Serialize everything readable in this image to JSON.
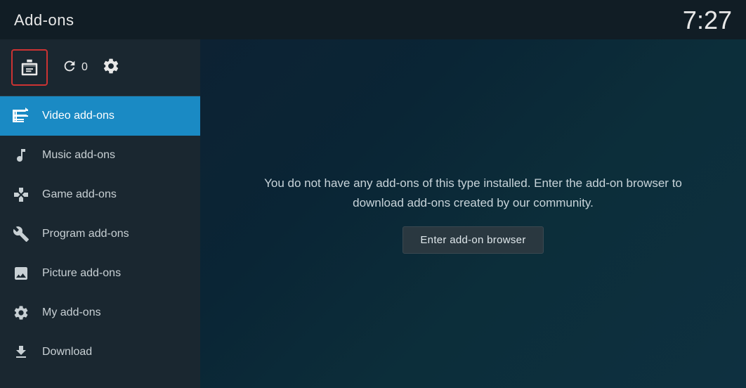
{
  "header": {
    "title": "Add-ons",
    "clock": "7:27"
  },
  "sidebar": {
    "icons": {
      "refresh_count": "0"
    },
    "nav_items": [
      {
        "id": "video-addons",
        "label": "Video add-ons",
        "icon": "video-icon",
        "active": true
      },
      {
        "id": "music-addons",
        "label": "Music add-ons",
        "icon": "music-icon",
        "active": false
      },
      {
        "id": "game-addons",
        "label": "Game add-ons",
        "icon": "game-icon",
        "active": false
      },
      {
        "id": "program-addons",
        "label": "Program add-ons",
        "icon": "program-icon",
        "active": false
      },
      {
        "id": "picture-addons",
        "label": "Picture add-ons",
        "icon": "picture-icon",
        "active": false
      },
      {
        "id": "my-addons",
        "label": "My add-ons",
        "icon": "myaddon-icon",
        "active": false
      },
      {
        "id": "download",
        "label": "Download",
        "icon": "download-icon",
        "active": false
      }
    ]
  },
  "content": {
    "empty_message": "You do not have any add-ons of this type installed. Enter the add-on browser to\ndownload add-ons created by our community.",
    "browser_button_label": "Enter add-on browser"
  }
}
